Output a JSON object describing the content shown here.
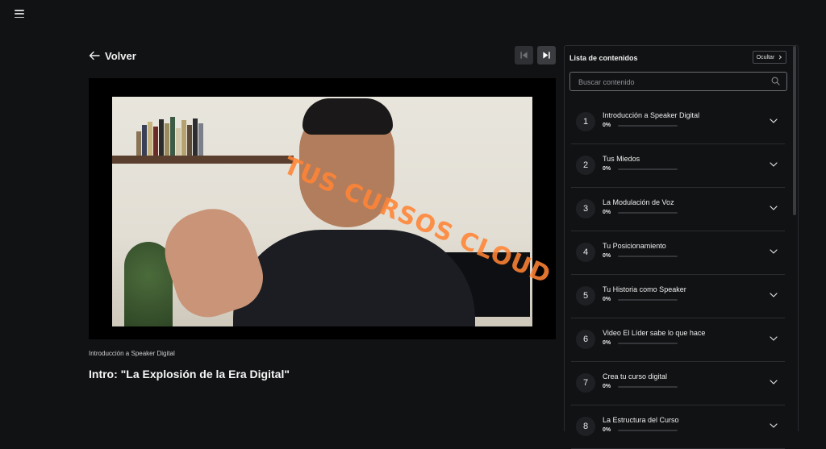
{
  "header": {
    "menu_icon": "hamburger-icon"
  },
  "back_label": "Volver",
  "nav": {
    "prev_icon": "skip-previous-icon",
    "next_icon": "skip-next-icon"
  },
  "video": {
    "watermark_text": "TUS CURSOS CLOUD",
    "watermark_color": "#ff8434",
    "watermark_icon": "rocket-icon"
  },
  "lesson": {
    "module": "Introducción a Speaker Digital",
    "title": "Intro: \"La Explosión de la Era Digital\""
  },
  "sidebar": {
    "title": "Lista de contenidos",
    "hide_label": "Ocultar",
    "search_placeholder": "Buscar contenido",
    "accent": "#ff8434",
    "items": [
      {
        "num": "1",
        "title": "Introducción a Speaker Digital",
        "progress": "0%",
        "progress_value": 0
      },
      {
        "num": "2",
        "title": "Tus Miedos",
        "progress": "0%",
        "progress_value": 0
      },
      {
        "num": "3",
        "title": "La Modulación de Voz",
        "progress": "0%",
        "progress_value": 0
      },
      {
        "num": "4",
        "title": "Tu Posicionamiento",
        "progress": "0%",
        "progress_value": 0
      },
      {
        "num": "5",
        "title": "Tu Historia como Speaker",
        "progress": "0%",
        "progress_value": 0
      },
      {
        "num": "6",
        "title": "Video El Líder sabe lo que hace",
        "progress": "0%",
        "progress_value": 0
      },
      {
        "num": "7",
        "title": "Crea tu curso digital",
        "progress": "0%",
        "progress_value": 0
      },
      {
        "num": "8",
        "title": "La Estructura del Curso",
        "progress": "0%",
        "progress_value": 0
      }
    ]
  }
}
